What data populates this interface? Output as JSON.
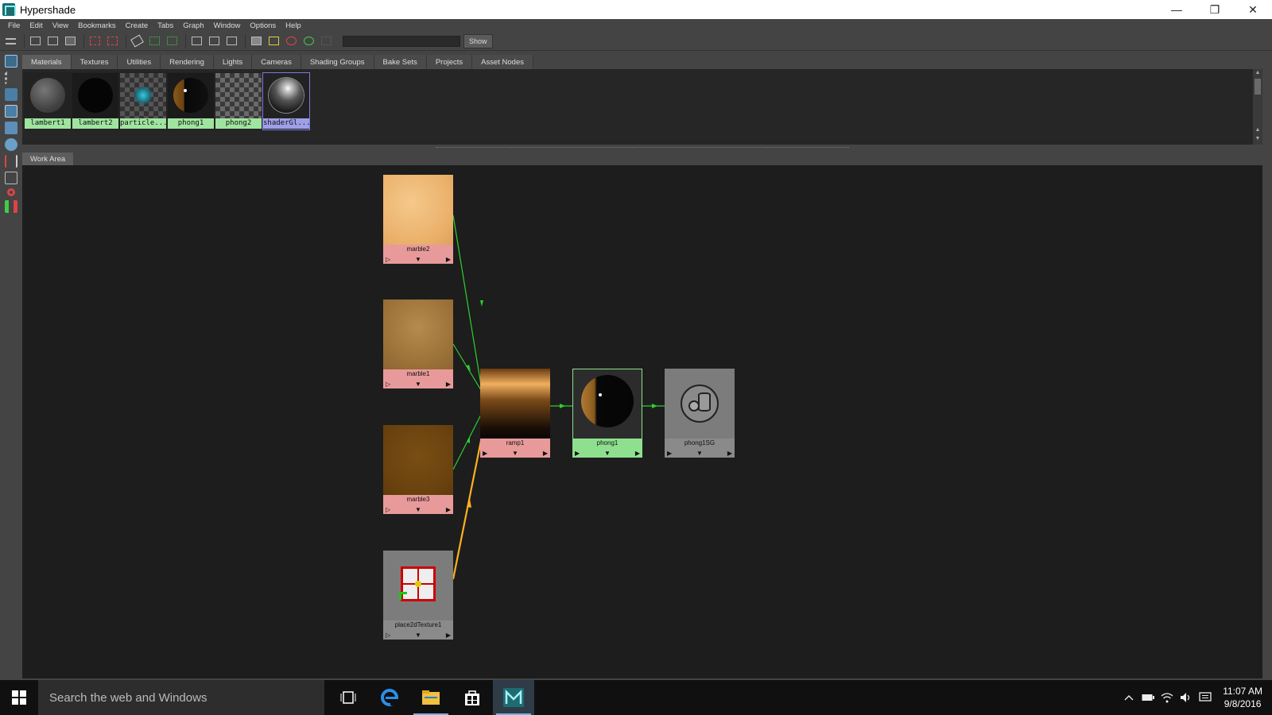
{
  "window": {
    "title": "Hypershade",
    "min": "—",
    "max": "❐",
    "close": "✕"
  },
  "menu": [
    "File",
    "Edit",
    "View",
    "Bookmarks",
    "Create",
    "Tabs",
    "Graph",
    "Window",
    "Options",
    "Help"
  ],
  "toolbar": {
    "show_label": "Show",
    "search_value": ""
  },
  "tabs": [
    "Materials",
    "Textures",
    "Utilities",
    "Rendering",
    "Lights",
    "Cameras",
    "Shading Groups",
    "Bake Sets",
    "Projects",
    "Asset Nodes"
  ],
  "swatches": [
    {
      "label": "lambert1",
      "kind": "gray-sphere"
    },
    {
      "label": "lambert2",
      "kind": "black-sphere"
    },
    {
      "label": "particle...",
      "kind": "checker-cyan"
    },
    {
      "label": "phong1",
      "kind": "phong"
    },
    {
      "label": "phong2",
      "kind": "checker"
    },
    {
      "label": "shaderGl...",
      "kind": "glossy",
      "selected": true
    }
  ],
  "work_area": {
    "tab_label": "Work Area",
    "nodes": {
      "marble2": "marble2",
      "marble1": "marble1",
      "marble3": "marble3",
      "place2d": "place2dTexture1",
      "ramp1": "ramp1",
      "phong1": "phong1",
      "phong1SG": "phong1SG"
    },
    "node_controls": {
      "left": "▷",
      "mid": "▼",
      "right": "▶"
    }
  },
  "taskbar": {
    "search_placeholder": "Search the web and Windows",
    "time": "11:07 AM",
    "date": "9/8/2016"
  },
  "colors": {
    "material_label": "#9fe59f",
    "selected_label": "#9f9fe8",
    "texture_node": "#e89a9a",
    "material_node": "#8ee08e",
    "wire_green": "#2fcf2f",
    "wire_orange": "#ffb020"
  }
}
